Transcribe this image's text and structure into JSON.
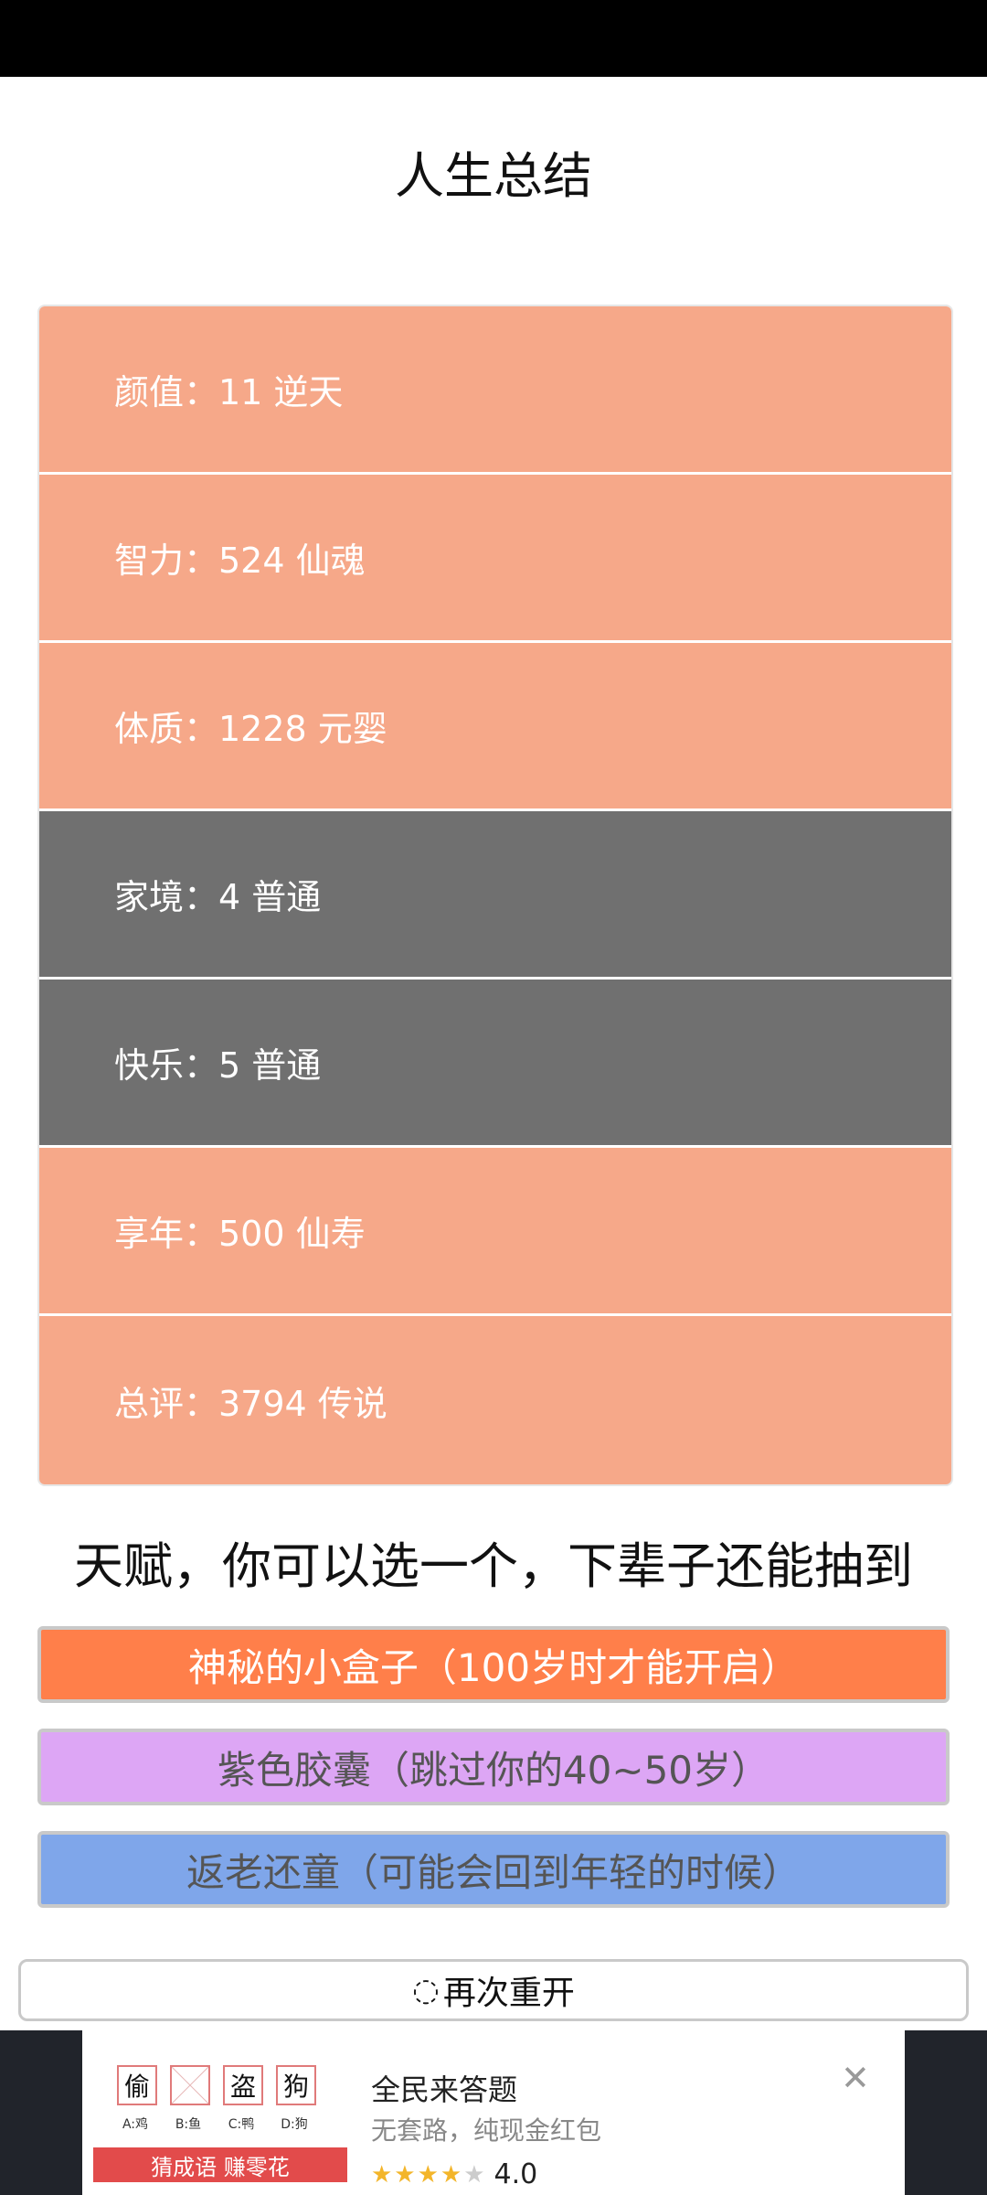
{
  "title": "人生总结",
  "stats": [
    {
      "label": "颜值：11 逆天",
      "tone": "gold"
    },
    {
      "label": "智力：524 仙魂",
      "tone": "gold"
    },
    {
      "label": "体质：1228 元婴",
      "tone": "gold"
    },
    {
      "label": "家境：4 普通",
      "tone": "gray"
    },
    {
      "label": "快乐：5 普通",
      "tone": "gray"
    },
    {
      "label": "享年：500 仙寿",
      "tone": "gold"
    },
    {
      "label": "总评：3794 传说",
      "tone": "gold"
    }
  ],
  "talent_heading": "天赋，你可以选一个，下辈子还能抽到",
  "talents": [
    {
      "label": "神秘的小盒子（100岁时才能开启）",
      "color": "#ff7f4a"
    },
    {
      "label": "紫色胶囊（跳过你的40~50岁）",
      "color": "#dda6f5"
    },
    {
      "label": "返老还童（可能会回到年轻的时候）",
      "color": "#7fa6ea"
    }
  ],
  "restart": {
    "icon": "spinner-icon",
    "label": "再次重开"
  },
  "ad": {
    "chars": [
      "偷",
      "",
      "盗",
      "狗"
    ],
    "captions": [
      "A:鸡",
      "B:鱼",
      "C:鸭",
      "D:狗"
    ],
    "banner": "猜成语 赚零花",
    "title": "全民来答题",
    "subtitle": "无套路，纯现金红包",
    "rating": "4.0",
    "stars_filled": 4,
    "stars_total": 5
  }
}
